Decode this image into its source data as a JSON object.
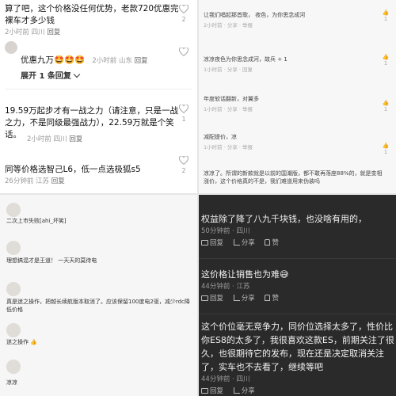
{
  "top_left": {
    "comments": [
      {
        "text": "算了吧，这个价格没任何优势，老款720优惠完裸车才多少钱",
        "time": "2小时前",
        "location": "四川",
        "reply": "回复",
        "likes": "2"
      },
      {
        "text": "优惠九万🤩🤩🤩",
        "time": "2小时前",
        "location": "山东",
        "reply": "回复",
        "likes": ""
      },
      {
        "text": "19.59万起步才有一战之力（请注意，只是一战之力，不是同级最强战力），22.59万就是个笑话。",
        "time": "2小时前",
        "location": "四川",
        "reply": "回复",
        "likes": "1"
      },
      {
        "text": "同等价格选智己L6，低一点选极狐s5",
        "time": "26分钟前",
        "location": "江苏",
        "reply": "回复",
        "likes": "2"
      }
    ],
    "expand_label": "展开 1 条回复"
  },
  "top_right": {
    "comments": [
      {
        "text": "让我们唱起那首歌，",
        "tail": "夜色，为你思念成河",
        "meta_time": "2小时前",
        "meta_share": "分享",
        "meta_reply": "举报",
        "likes": "1"
      },
      {
        "text": "凉凉夜色为你思念成河，故兵 + 1",
        "meta_time": "1小时前",
        "meta_share": "分享",
        "meta_reply": "回复",
        "likes": "1"
      },
      {
        "text": "年度软话翻新，对翼多",
        "meta_time": "1小时前",
        "meta_share": "分享",
        "meta_reply": "举报",
        "likes": "1"
      },
      {
        "text": "减配提价，凉",
        "meta_time": "1小时前",
        "meta_share": "分享",
        "meta_reply": "举报",
        "likes": "1"
      },
      {
        "text": "凉凉了。所谓的新款就是以前的国潮版，都不敢再落座88%的，就是变相涨价，这个价格真的不是，我们难道用来伪装吗",
        "meta_time": "",
        "meta_share": "",
        "meta_reply": "",
        "likes": ""
      }
    ]
  },
  "bottom_left": {
    "comments": [
      {
        "name": "",
        "text": "二次上市失败[ahi_坏笑]",
        "meta": ""
      },
      {
        "name": "",
        "text": "理想搞混才是王道！ 一天天的莫待电",
        "meta": ""
      },
      {
        "name": "",
        "text": "真是迷之操作，把越长续航版本取消了。应该保留100度电2驱，减少rdc降低价格",
        "meta": ""
      },
      {
        "name": "",
        "text": "迷之操作 👍",
        "meta": ""
      },
      {
        "name": "",
        "text": "凉凉",
        "meta": ""
      }
    ]
  },
  "bottom_right": {
    "comments": [
      {
        "text": "权益除了降了八九千块钱，也没啥有用的，",
        "time": "50分钟前",
        "location": "四川",
        "reply": "回复",
        "share": "分享",
        "like": "赞"
      },
      {
        "text": "这价格让销售也为难😅",
        "time": "44分钟前",
        "location": "江苏",
        "reply": "回复",
        "share": "分享",
        "like": "赞"
      },
      {
        "text": "这个价位毫无竞争力，同价位选择太多了，性价比你ES8的太多了，我很喜欢这款ES，前期关注了很久，也很期待它的发布，现在还是决定取消关注了，实车也不去看了，继续等吧",
        "time": "44分钟前",
        "location": "四川",
        "reply": "回复",
        "share": "分享",
        "like": "赞"
      }
    ]
  },
  "colors": {
    "dark_bg": "#2a2a2a",
    "meta_gray": "#999999",
    "text_dark": "#111111"
  }
}
